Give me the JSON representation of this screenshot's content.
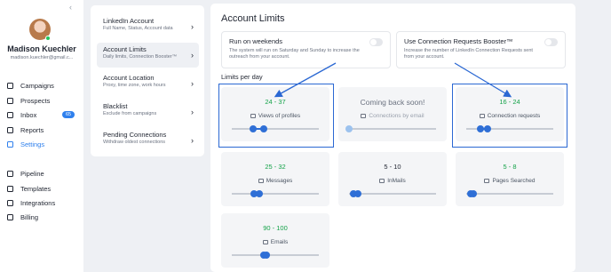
{
  "user": {
    "name": "Madison Kuechler",
    "email": "madison.kuechler@gmail.c..."
  },
  "nav": [
    {
      "label": "Campaigns",
      "icon": "campaigns-icon"
    },
    {
      "label": "Prospects",
      "icon": "prospects-icon"
    },
    {
      "label": "Inbox",
      "icon": "inbox-icon",
      "badge": "65"
    },
    {
      "label": "Reports",
      "icon": "reports-icon"
    },
    {
      "label": "Settings",
      "icon": "gear-icon",
      "active": true
    },
    {
      "label": "Pipeline",
      "icon": "pipeline-icon"
    },
    {
      "label": "Templates",
      "icon": "bookmark-icon"
    },
    {
      "label": "Integrations",
      "icon": "integrations-icon"
    },
    {
      "label": "Billing",
      "icon": "billing-icon"
    }
  ],
  "submenu": [
    {
      "title": "LinkedIn Account",
      "desc": "Full Name, Status, Account data"
    },
    {
      "title": "Account Limits",
      "desc": "Daily limits, Connection Booster™",
      "active": true
    },
    {
      "title": "Account Location",
      "desc": "Proxy, time zone, work hours"
    },
    {
      "title": "Blacklist",
      "desc": "Exclude from campaigns"
    },
    {
      "title": "Pending Connections",
      "desc": "Withdraw oldest connections"
    }
  ],
  "main": {
    "title": "Account Limits",
    "weekends": {
      "title": "Run on weekends",
      "desc": "The system will run on Saturday and Sunday to increase the outreach from your account."
    },
    "booster": {
      "title": "Use Connection Requests Booster™",
      "desc": "Increase the number of LinkedIn Connection Requests sent from your account."
    },
    "section_label": "Limits per day"
  },
  "limits": [
    {
      "value": "24 - 37",
      "label": "Views of profiles",
      "icon": "eye-icon",
      "range": [
        0.24,
        0.37
      ]
    },
    {
      "value": "Coming back soon!",
      "label": "Connections by email",
      "icon": "email-icon",
      "range": [
        0.0,
        0.0
      ],
      "muted": true
    },
    {
      "value": "16 - 24",
      "label": "Connection requests",
      "icon": "user-plus-icon",
      "range": [
        0.16,
        0.24
      ]
    },
    {
      "value": "25 - 32",
      "label": "Messages",
      "icon": "message-icon",
      "range": [
        0.25,
        0.32
      ]
    },
    {
      "value": "5 - 10",
      "label": "InMails",
      "icon": "inmail-icon",
      "range": [
        0.05,
        0.1
      ],
      "dark": true
    },
    {
      "value": "5 - 8",
      "label": "Pages Searched",
      "icon": "search-icon",
      "range": [
        0.05,
        0.08
      ]
    },
    {
      "value": "90 - 100",
      "label": "Emails",
      "icon": "mail-icon",
      "range": [
        0.37,
        0.4
      ]
    }
  ],
  "colors": {
    "accent": "#2f80ed",
    "green": "#16a34a",
    "annotation": "#2b68d3"
  }
}
